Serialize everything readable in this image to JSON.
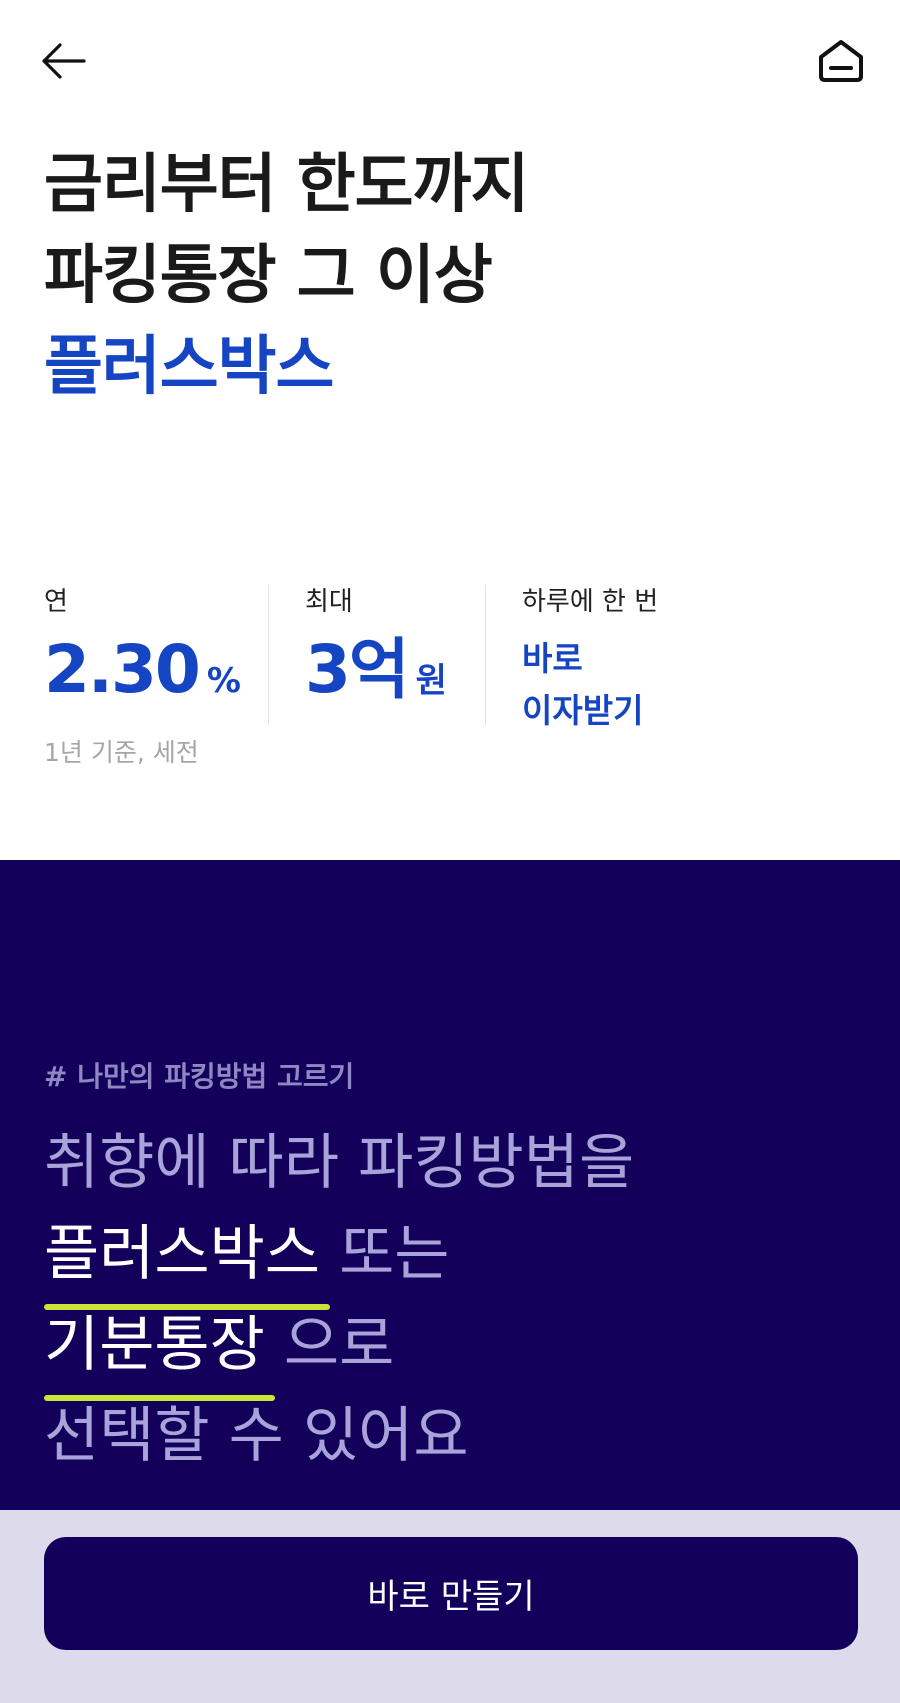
{
  "header": {
    "back_icon": "arrow-left-icon",
    "home_icon": "home-icon"
  },
  "headline": {
    "line1": "금리부터 한도까지",
    "line2": "파킹통장 그 이상",
    "line3": "플러스박스"
  },
  "stats": {
    "rate": {
      "label": "연",
      "value": "2.30",
      "unit": "%",
      "note": "1년 기준, 세전"
    },
    "limit": {
      "label": "최대",
      "value": "3억",
      "unit": "원"
    },
    "interest": {
      "label": "하루에 한 번",
      "line1": "바로",
      "line2": "이자받기"
    }
  },
  "promo": {
    "hashtag": "# 나만의 파킹방법 고르기",
    "line1": "취향에 따라 파킹방법을",
    "option1": "플러스박스",
    "connector1": "또는",
    "option2": "기분통장",
    "connector2": "으로",
    "line4": "선택할 수 있어요"
  },
  "cta": {
    "label": "바로 만들기"
  },
  "colors": {
    "accent": "#1645c3",
    "dark_bg": "#12005a",
    "highlight": "#c8e63a",
    "bottom_bar": "#dcdaeb"
  }
}
